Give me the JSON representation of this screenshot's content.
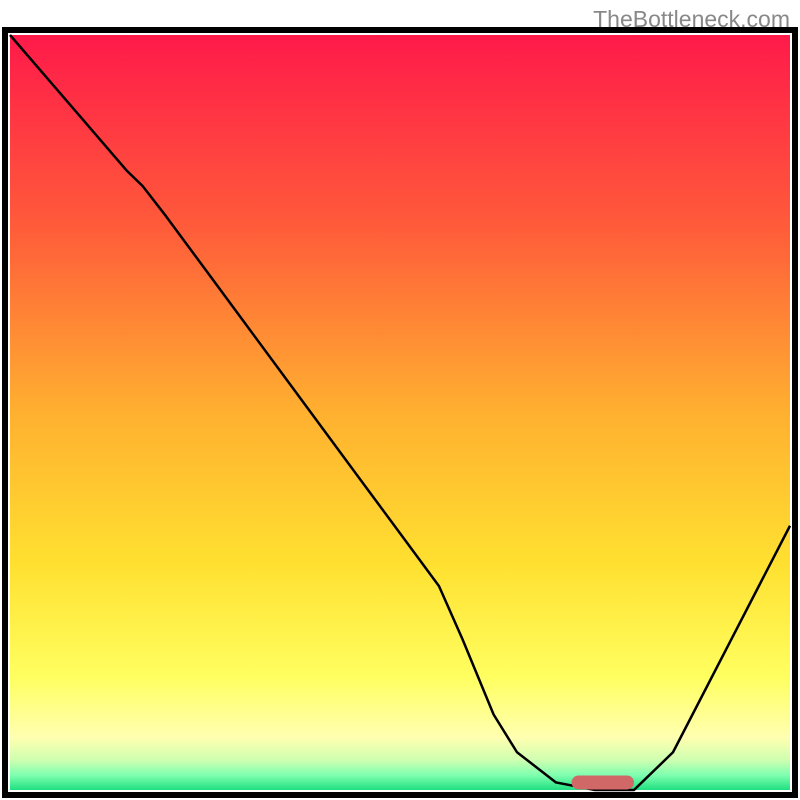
{
  "watermark": "TheBottleneck.com",
  "chart_data": {
    "type": "line",
    "title": "",
    "xlabel": "",
    "ylabel": "",
    "x": [
      0,
      5,
      10,
      15,
      17,
      20,
      25,
      30,
      35,
      40,
      45,
      50,
      55,
      58,
      62,
      65,
      70,
      75,
      80,
      85,
      90,
      95,
      100
    ],
    "values": [
      100,
      94,
      88,
      82,
      80,
      76,
      69,
      62,
      55,
      48,
      41,
      34,
      27,
      20,
      10,
      5,
      1,
      0,
      0,
      5,
      15,
      25,
      35
    ],
    "xlim": [
      0,
      100
    ],
    "ylim": [
      0,
      100
    ],
    "marker": {
      "x_start": 72,
      "x_end": 80,
      "y": 1,
      "color": "#d06868"
    },
    "gradient_stops": [
      {
        "offset": 0,
        "color": "#ff1a4a"
      },
      {
        "offset": 25,
        "color": "#ff5a3a"
      },
      {
        "offset": 50,
        "color": "#ffb030"
      },
      {
        "offset": 70,
        "color": "#ffe030"
      },
      {
        "offset": 85,
        "color": "#ffff60"
      },
      {
        "offset": 93,
        "color": "#ffffb0"
      },
      {
        "offset": 96,
        "color": "#d0ffb0"
      },
      {
        "offset": 98,
        "color": "#80ffb0"
      },
      {
        "offset": 100,
        "color": "#20e080"
      }
    ],
    "grid": false,
    "legend": false
  },
  "plot": {
    "outer_left": 5,
    "outer_top": 30,
    "outer_width": 790,
    "outer_height": 765,
    "inner_pad": 5
  }
}
